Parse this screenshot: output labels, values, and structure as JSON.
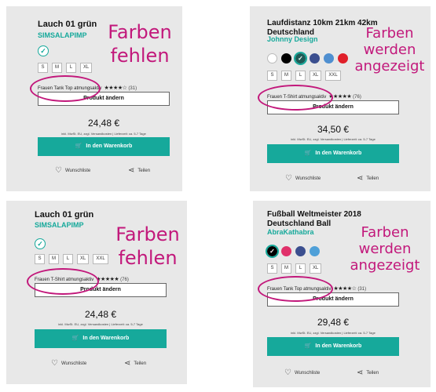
{
  "cards": [
    {
      "title": "Lauch 01 grün",
      "brand": "SIMSALAPIMP",
      "sizes": [
        "S",
        "M",
        "L",
        "XL"
      ],
      "product_type": "Frauen Tank Top atmungsaktiv",
      "stars": "★★★★☆",
      "rating_count": "(31)",
      "change_label": "Produkt ändern",
      "price": "24,48 €",
      "price_note": "inkl. MwSt. EU, zzgl. Versandkosten | Lieferzeit: ca. 5-7 Tage",
      "cart_label": "In den Warenkorb",
      "wishlist_label": "Wunschliste",
      "share_label": "Teilen",
      "annotation": "Farben fehlen"
    },
    {
      "title": "Laufdistanz 10km 21km 42km Deutschland",
      "brand": "Johnny Design",
      "colors": [
        "#ffffff",
        "#000000",
        "#1f5a55",
        "#3b4f8f",
        "#4f8fd0",
        "#e0202a"
      ],
      "selected_color_index": 2,
      "sizes": [
        "S",
        "M",
        "L",
        "XL",
        "XXL"
      ],
      "product_type": "Frauen T-Shirt atmungsaktiv",
      "stars": "★★★★★",
      "rating_count": "(76)",
      "change_label": "Produkt ändern",
      "price": "34,50 €",
      "price_note": "inkl. MwSt. EU, zzgl. Versandkosten | Lieferzeit: ca. 5-7 Tage",
      "cart_label": "In den Warenkorb",
      "wishlist_label": "Wunschliste",
      "share_label": "Teilen",
      "annotation": "Farben werden angezeigt"
    },
    {
      "title": "Lauch 01 grün",
      "brand": "SIMSALAPIMP",
      "sizes": [
        "S",
        "M",
        "L",
        "XL",
        "XXL"
      ],
      "product_type": "Frauen T-Shirt atmungsaktiv",
      "stars": "★★★★★",
      "rating_count": "(76)",
      "change_label": "Produkt ändern",
      "price": "24,48 €",
      "price_note": "inkl. MwSt. EU, zzgl. Versandkosten | Lieferzeit: ca. 5-7 Tage",
      "cart_label": "In den Warenkorb",
      "wishlist_label": "Wunschliste",
      "share_label": "Teilen",
      "annotation": "Farben fehlen"
    },
    {
      "title": "Fußball Weltmeister 2018 Deutschland Ball",
      "brand": "AbraKathabra",
      "colors": [
        "#000000",
        "#e0306a",
        "#3b4f8f",
        "#4fa0d8"
      ],
      "selected_color_index": 0,
      "sizes": [
        "S",
        "M",
        "L",
        "XL"
      ],
      "product_type": "Frauen Tank Top atmungsaktiv",
      "stars": "★★★★☆",
      "rating_count": "(31)",
      "change_label": "Produkt ändern",
      "price": "29,48 €",
      "price_note": "inkl. MwSt. EU, zzgl. Versandkosten | Lieferzeit: ca. 5-7 Tage",
      "cart_label": "In den Warenkorb",
      "wishlist_label": "Wunschliste",
      "share_label": "Teilen",
      "annotation": "Farben werden angezeigt"
    }
  ],
  "accent_color": "#16a99b",
  "annotation_color": "#c2187b"
}
